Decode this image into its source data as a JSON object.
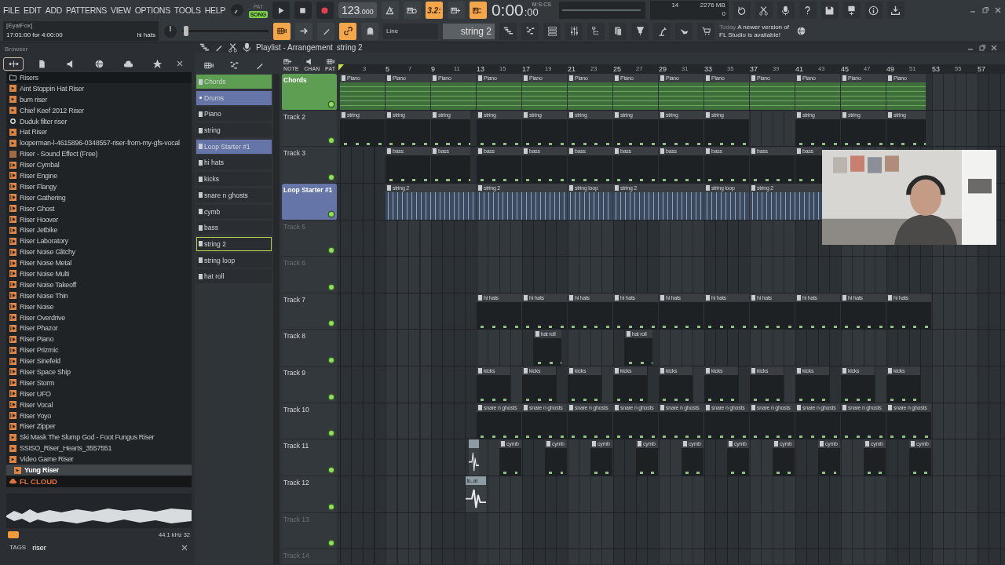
{
  "menu": [
    "FILE",
    "EDIT",
    "ADD",
    "PATTERNS",
    "VIEW",
    "OPTIONS",
    "TOOLS",
    "HELP"
  ],
  "hint": {
    "user": "[EyalFox]",
    "text": "17:01:00 for 4:00:00",
    "target": "hi hats"
  },
  "modes": [
    {
      "label": "PAT",
      "selected": false
    },
    {
      "label": "SONG",
      "selected": true
    }
  ],
  "transport": [
    {
      "kind": "play"
    },
    {
      "kind": "stop"
    },
    {
      "kind": "record"
    }
  ],
  "tempo": {
    "value": "123",
    "decimals": ".000"
  },
  "tools_top": [
    {
      "kind": "metronome",
      "on": false
    },
    {
      "kind": "wait",
      "on": false
    },
    {
      "kind": "countdown",
      "label": "3.2:",
      "on": true
    },
    {
      "kind": "keys-plus",
      "on": false
    },
    {
      "kind": "keys-loop",
      "on": true
    }
  ],
  "time": {
    "value": "0:00",
    "small": ":00",
    "unit": "M:S:CS"
  },
  "song_position": {
    "level": 0.02
  },
  "monitor": {
    "cpu": "14",
    "memory": "2276 MB",
    "voices": "0"
  },
  "tools_right": [
    {
      "kind": "undo"
    },
    {
      "kind": "cut"
    },
    {
      "kind": "mic"
    },
    {
      "kind": "help"
    },
    {
      "kind": "save"
    },
    {
      "kind": "save-new"
    },
    {
      "kind": "info"
    },
    {
      "kind": "download"
    }
  ],
  "tools_bottom": [
    {
      "kind": "step",
      "on": true
    },
    {
      "kind": "arrow",
      "on": false
    },
    {
      "kind": "slide",
      "on": false
    },
    {
      "kind": "link",
      "on": true
    },
    {
      "kind": "bell",
      "on": false
    }
  ],
  "snap": {
    "value": "Line"
  },
  "pattern_selector": {
    "value": "string 2"
  },
  "views": [
    {
      "kind": "playlist"
    },
    {
      "kind": "piano-roll"
    },
    {
      "kind": "channel-rack"
    },
    {
      "kind": "mixer"
    },
    {
      "kind": "project-tree"
    },
    {
      "kind": "clipboard"
    },
    {
      "kind": "plugin"
    },
    {
      "kind": "lamp"
    },
    {
      "kind": "hand"
    },
    {
      "kind": "cart"
    }
  ],
  "news": {
    "day": "Today",
    "text": "A newer version of FL Studio is available!"
  },
  "browser": {
    "title": "Browser",
    "tabs": [
      {
        "kind": "all",
        "selected": true
      },
      {
        "kind": "project",
        "selected": false
      },
      {
        "kind": "current",
        "selected": false
      },
      {
        "kind": "online",
        "selected": false
      },
      {
        "kind": "cloud",
        "selected": false
      },
      {
        "kind": "favorite",
        "selected": false
      }
    ],
    "folder": "Risers",
    "items": [
      {
        "label": "Aint Stoppin Hat Riser",
        "kind": "audio",
        "selected": false
      },
      {
        "label": "burn riser",
        "kind": "audio",
        "selected": false
      },
      {
        "label": "Chief Keef 2012 Riser",
        "kind": "audio",
        "selected": false
      },
      {
        "label": "Duduk filter riser",
        "kind": "plugin",
        "selected": false
      },
      {
        "label": "Hat Riser",
        "kind": "audio",
        "selected": false
      },
      {
        "label": "looperman-l-4615896-0348557-riser-from-my-gfs-vocal",
        "kind": "audio",
        "selected": false
      },
      {
        "label": "Riser - Sound Effect (Free)",
        "kind": "mp3",
        "selected": false
      },
      {
        "label": "Riser Cymbal",
        "kind": "loop",
        "selected": false
      },
      {
        "label": "Riser Engine",
        "kind": "loop",
        "selected": false
      },
      {
        "label": "Riser Flangy",
        "kind": "loop",
        "selected": false
      },
      {
        "label": "Riser Gathering",
        "kind": "loop",
        "selected": false
      },
      {
        "label": "Riser Ghost",
        "kind": "loop",
        "selected": false
      },
      {
        "label": "Riser Hoover",
        "kind": "loop",
        "selected": false
      },
      {
        "label": "Riser Jetbike",
        "kind": "loop",
        "selected": false
      },
      {
        "label": "Riser Laboratory",
        "kind": "loop",
        "selected": false
      },
      {
        "label": "Riser Noise Glitchy",
        "kind": "loop",
        "selected": false
      },
      {
        "label": "Riser Noise Metal",
        "kind": "loop",
        "selected": false
      },
      {
        "label": "Riser Noise Multi",
        "kind": "loop",
        "selected": false
      },
      {
        "label": "Riser Noise Takeoff",
        "kind": "loop",
        "selected": false
      },
      {
        "label": "Riser Noise Thin",
        "kind": "loop",
        "selected": false
      },
      {
        "label": "Riser Noise",
        "kind": "loop",
        "selected": false
      },
      {
        "label": "Riser Overdrive",
        "kind": "loop",
        "selected": false
      },
      {
        "label": "Riser Phazor",
        "kind": "loop",
        "selected": false
      },
      {
        "label": "Riser Piano",
        "kind": "loop",
        "selected": false
      },
      {
        "label": "Riser Prizmic",
        "kind": "loop",
        "selected": false
      },
      {
        "label": "Riser Sinefeld",
        "kind": "loop",
        "selected": false
      },
      {
        "label": "Riser Space Ship",
        "kind": "loop",
        "selected": false
      },
      {
        "label": "Riser Storm",
        "kind": "loop",
        "selected": false
      },
      {
        "label": "Riser UFO",
        "kind": "loop",
        "selected": false
      },
      {
        "label": "Riser Vocal",
        "kind": "loop",
        "selected": false
      },
      {
        "label": "Riser Yoyo",
        "kind": "loop",
        "selected": false
      },
      {
        "label": "Riser Zipper",
        "kind": "loop",
        "selected": false
      },
      {
        "label": "Ski Mask The Slump God - Foot Fungus Riser",
        "kind": "audio",
        "selected": false
      },
      {
        "label": "SSISO_Riser_Hearts_3557551",
        "kind": "audio",
        "selected": false
      },
      {
        "label": "Video Game Riser",
        "kind": "audio",
        "selected": false
      },
      {
        "label": "Yung Riser",
        "kind": "audio",
        "selected": true
      }
    ],
    "cloud": "FL CLOUD",
    "sample_info": "44.1 kHz 32",
    "tags": {
      "label": "TAGS",
      "value": "riser"
    }
  },
  "playlist": {
    "title": "Playlist - Arrangement",
    "pattern": "string 2",
    "header_labels": [
      "NOTE",
      "CHAN",
      "PAT"
    ],
    "patterns": [
      {
        "label": "Chords",
        "kind": "pattern",
        "color": "#5d9e52",
        "selected": false
      },
      {
        "label": "Drums",
        "kind": "group",
        "color": "#6675a8",
        "selected": false
      },
      {
        "label": "Piano",
        "kind": "pattern",
        "selected": false
      },
      {
        "label": "string",
        "kind": "pattern",
        "selected": false
      },
      {
        "label": "Loop Starter #1",
        "kind": "pattern",
        "color": "#6675a8",
        "selected": false
      },
      {
        "label": "hi hats",
        "kind": "pattern",
        "selected": false
      },
      {
        "label": "kicks",
        "kind": "pattern",
        "selected": false
      },
      {
        "label": "snare n ghosts",
        "kind": "pattern",
        "selected": false
      },
      {
        "label": "cymb",
        "kind": "pattern",
        "selected": false
      },
      {
        "label": "bass",
        "kind": "pattern",
        "selected": false
      },
      {
        "label": "string 2",
        "kind": "pattern",
        "selected": true
      },
      {
        "label": "string loop",
        "kind": "pattern",
        "selected": false
      },
      {
        "label": "hat roll",
        "kind": "pattern",
        "selected": false
      }
    ],
    "ruler": [
      "3",
      "5",
      "7",
      "9",
      "11",
      "13",
      "15",
      "17",
      "19",
      "21",
      "23",
      "25",
      "27",
      "29",
      "31",
      "33",
      "35",
      "37",
      "39",
      "41",
      "43",
      "45",
      "47",
      "49",
      "51",
      "53",
      "55",
      "57"
    ],
    "tracks": [
      {
        "name": "Chords",
        "color": "#5d9e52",
        "empty": false,
        "on": true,
        "clips": [
          {
            "label": "Piano"
          },
          {
            "label": "Piano"
          },
          {
            "label": "Piano"
          },
          {
            "label": "Piano"
          },
          {
            "label": "Piano"
          },
          {
            "label": "Piano"
          },
          {
            "label": "Piano"
          },
          {
            "label": "Piano"
          },
          {
            "label": "Piano"
          },
          {
            "label": "Piano"
          },
          {
            "label": "Piano"
          },
          {
            "label": "Piano"
          },
          {
            "label": "Piano"
          }
        ]
      },
      {
        "name": "Track 2",
        "empty": false,
        "on": true,
        "clips": [
          {
            "label": "string"
          },
          {
            "label": "string"
          },
          {
            "label": "string"
          },
          {
            "label": "string"
          },
          {
            "label": "string"
          },
          {
            "label": "string"
          },
          {
            "label": "string"
          },
          {
            "label": "string"
          },
          {
            "label": "string"
          },
          {
            "label": "string"
          },
          {
            "label": "string"
          },
          {
            "label": "string"
          }
        ]
      },
      {
        "name": "Track 3",
        "empty": false,
        "on": true,
        "clips": [
          {
            "label": "bass"
          },
          {
            "label": "bass"
          },
          {
            "label": "bass"
          },
          {
            "label": "bass"
          },
          {
            "label": "bass"
          },
          {
            "label": "bass"
          },
          {
            "label": "bass"
          },
          {
            "label": "bass"
          },
          {
            "label": "bass"
          },
          {
            "label": "bass"
          }
        ]
      },
      {
        "name": "Loop Starter #1",
        "color": "#6675a8",
        "empty": false,
        "on": true,
        "clips": [
          {
            "label": "string 2"
          },
          {
            "label": "string 2"
          },
          {
            "label": "string loop"
          },
          {
            "label": "string 2"
          },
          {
            "label": "string loop"
          },
          {
            "label": "string 2"
          }
        ]
      },
      {
        "name": "Track 5",
        "empty": true,
        "on": true
      },
      {
        "name": "Track 6",
        "empty": true,
        "on": true
      },
      {
        "name": "Track 7",
        "empty": false,
        "on": true,
        "clips": [
          {
            "label": "hi hats"
          },
          {
            "label": "hi hats"
          },
          {
            "label": "hi hats"
          },
          {
            "label": "hi hats"
          },
          {
            "label": "hi hats"
          },
          {
            "label": "hi hats"
          },
          {
            "label": "hi hats"
          },
          {
            "label": "hi hats"
          },
          {
            "label": "hi hats"
          },
          {
            "label": "hi hats"
          }
        ]
      },
      {
        "name": "Track 8",
        "empty": false,
        "on": true,
        "clips": [
          {
            "label": "hat roll"
          },
          {
            "label": "hat roll"
          }
        ]
      },
      {
        "name": "Track 9",
        "empty": false,
        "on": true,
        "clips": [
          {
            "label": "kicks"
          },
          {
            "label": "kicks"
          },
          {
            "label": "kicks"
          },
          {
            "label": "kicks"
          },
          {
            "label": "kicks"
          },
          {
            "label": "kicks"
          },
          {
            "label": "kicks"
          },
          {
            "label": "kicks"
          },
          {
            "label": "kicks"
          },
          {
            "label": "kicks"
          }
        ]
      },
      {
        "name": "Track 10",
        "empty": false,
        "on": true,
        "clips": [
          {
            "label": "snare n ghosts"
          },
          {
            "label": "snare n ghosts"
          },
          {
            "label": "snare n ghosts"
          },
          {
            "label": "snare n ghosts"
          },
          {
            "label": "snare n ghosts"
          },
          {
            "label": "snare n ghosts"
          },
          {
            "label": "snare n ghosts"
          },
          {
            "label": "snare n ghosts"
          },
          {
            "label": "snare n ghosts"
          },
          {
            "label": "snare n ghosts"
          }
        ]
      },
      {
        "name": "Track 11",
        "empty": false,
        "on": true,
        "clips": [
          {
            "kind": "audio"
          },
          {
            "label": "cymb"
          },
          {
            "label": "cymb"
          },
          {
            "label": "cymb"
          },
          {
            "label": "cymb"
          },
          {
            "label": "cymb"
          },
          {
            "label": "cymb"
          },
          {
            "label": "cymb"
          },
          {
            "label": "cymb"
          },
          {
            "label": "cymb"
          },
          {
            "label": "cymb"
          }
        ]
      },
      {
        "name": "Track 12",
        "empty": false,
        "on": true,
        "clips": [
          {
            "kind": "audio",
            "label": "lo..al"
          }
        ]
      },
      {
        "name": "Track 13",
        "empty": true,
        "on": true
      },
      {
        "name": "Track 14",
        "empty": true
      }
    ]
  }
}
